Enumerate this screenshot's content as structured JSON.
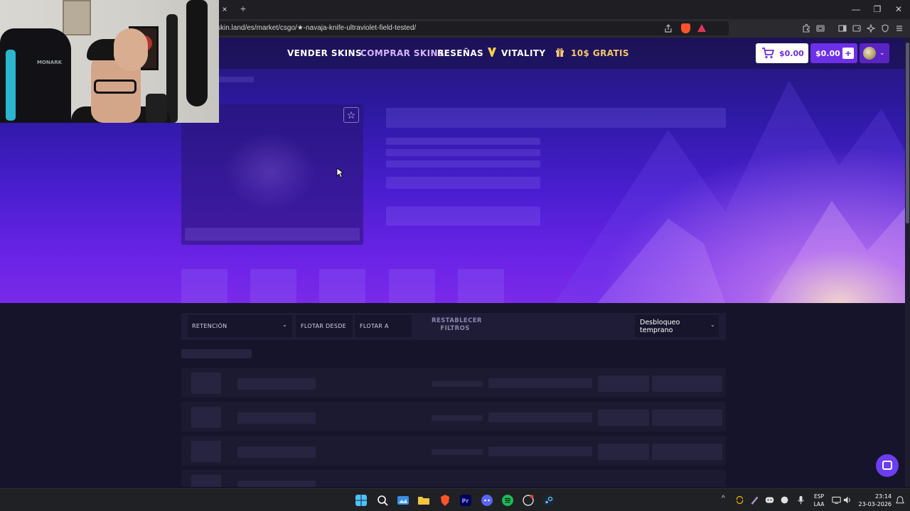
{
  "browser": {
    "url": "skin.land/es/market/csgo/★-navaja-knife-ultraviolet-field-tested/",
    "tab_close": "×",
    "new_tab": "+",
    "minimize": "—",
    "restore": "❐",
    "close": "✕"
  },
  "nav": {
    "sell": "VENDER SKINS",
    "buy": "COMPRAR SKINS",
    "reviews": "RESEÑAS",
    "vitality": "VITALITY",
    "free": "10$ GRATIS",
    "cart_amount": "$0.00",
    "wallet_amount": "$0.00",
    "plus": "+",
    "chevron": "⌄"
  },
  "product": {
    "favorite_star": "☆"
  },
  "filters": {
    "retention": "RETENCIÓN",
    "float_from": "FLOTAR DESDE",
    "float_to": "FLOTAR A",
    "reset": "RESTABLECER FILTROS",
    "unlock_select": "Desbloqueo temprano",
    "chevron": "⌄"
  },
  "taskbar": {
    "lang": "ESP\nLAA",
    "lang_top": "ESP",
    "lang_bottom": "LAA",
    "time": "23:14",
    "date": "23-03-2026",
    "tray_up": "^"
  },
  "webcam": {
    "chair_brand": "MONARK"
  },
  "colors": {
    "accent": "#6e2fe8",
    "hero_top": "#23166f",
    "hero_bottom": "#7a2ae8",
    "page_bg": "#16142a",
    "nav_accent": "#d7b4ff",
    "nav_gold": "#f5c96a"
  }
}
